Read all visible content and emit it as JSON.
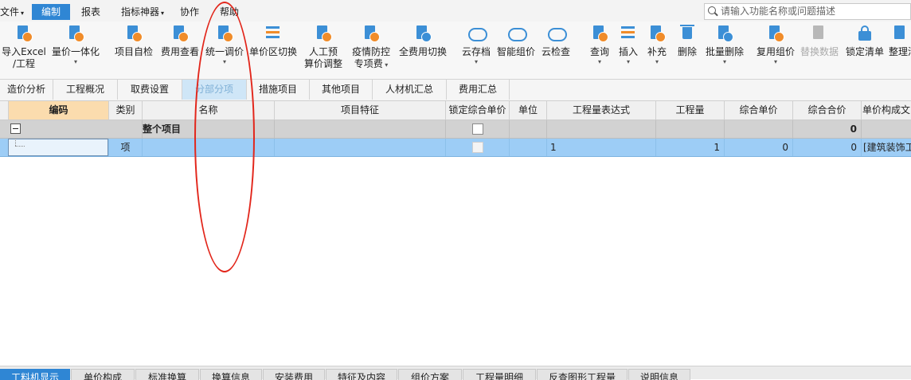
{
  "menu": {
    "file": "文件",
    "edit": "编制",
    "report": "报表",
    "indicator": "指标神器",
    "collab": "协作",
    "help": "帮助"
  },
  "search": {
    "placeholder": "请输入功能名称或问题描述"
  },
  "ribbon": {
    "import_excel_1": "导入Excel",
    "import_excel_2": "/工程",
    "qty_price": "量价一体化",
    "self_check": "项目自检",
    "fee_view": "费用查看",
    "unify_price": "统一调价",
    "unit_price_switch": "单价区切换",
    "labor_1": "人工预",
    "labor_2": "算价调整",
    "epidemic_1": "疫情防控",
    "epidemic_2": "专项费",
    "all_fee_switch": "全费用切换",
    "cloud_save": "云存档",
    "smart_price": "智能组价",
    "cloud_check": "云检查",
    "query": "查询",
    "insert": "插入",
    "supplement": "补充",
    "delete": "删除",
    "batch_delete": "批量删除",
    "reuse_price": "复用组价",
    "replace_data": "替换数据",
    "lock_list": "锁定清单",
    "organize": "整理清"
  },
  "tabs": [
    "造价分析",
    "工程概况",
    "取费设置",
    "分部分项",
    "措施项目",
    "其他项目",
    "人材机汇总",
    "费用汇总"
  ],
  "active_tab": "分部分项",
  "columns": [
    "编码",
    "类别",
    "名称",
    "项目特征",
    "锁定综合单价",
    "单位",
    "工程量表达式",
    "工程量",
    "综合单价",
    "综合合价",
    "单价构成文"
  ],
  "rows": {
    "summary": {
      "name": "整个项目",
      "total": "0"
    },
    "item": {
      "category": "项",
      "qty_expr": "1",
      "qty": "1",
      "unit_price": "0",
      "total_price": "0",
      "composition": "[建筑装饰工"
    }
  },
  "bottom_tabs": [
    "工料机显示",
    "单价构成",
    "标准换算",
    "换算信息",
    "安装费用",
    "特征及内容",
    "组价方案",
    "工程量明细",
    "反查图形工程量",
    "说明信息"
  ],
  "colors": {
    "accent": "#2f86d4",
    "selected_row": "#9dcdf6",
    "header_selected": "#fbdcae",
    "annotation": "#e2261b"
  }
}
